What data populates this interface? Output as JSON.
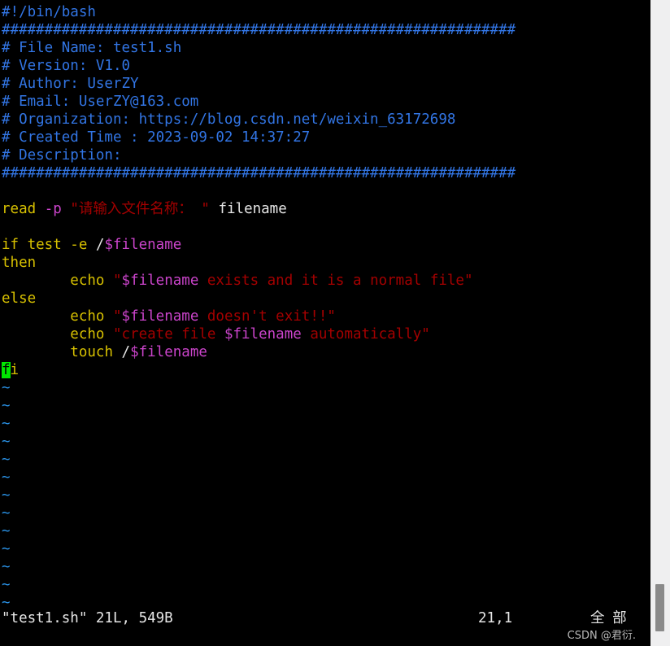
{
  "editor": {
    "name": "vim",
    "filename": "test1.sh"
  },
  "code_lines": [
    {
      "kind": "code",
      "spans": [
        {
          "t": "#!/bin/bash",
          "c": "c-comment"
        }
      ]
    },
    {
      "kind": "code",
      "spans": [
        {
          "t": "############################################################",
          "c": "c-comment"
        }
      ]
    },
    {
      "kind": "code",
      "spans": [
        {
          "t": "# File Name: test1.sh",
          "c": "c-comment"
        }
      ]
    },
    {
      "kind": "code",
      "spans": [
        {
          "t": "# Version: V1.0",
          "c": "c-comment"
        }
      ]
    },
    {
      "kind": "code",
      "spans": [
        {
          "t": "# Author: UserZY",
          "c": "c-comment"
        }
      ]
    },
    {
      "kind": "code",
      "spans": [
        {
          "t": "# Email: UserZY@163.com",
          "c": "c-comment"
        }
      ]
    },
    {
      "kind": "code",
      "spans": [
        {
          "t": "# Organization: https://blog.csdn.net/weixin_63172698",
          "c": "c-comment"
        }
      ]
    },
    {
      "kind": "code",
      "spans": [
        {
          "t": "# Created Time : 2023-09-02 14:37:27",
          "c": "c-comment"
        }
      ]
    },
    {
      "kind": "code",
      "spans": [
        {
          "t": "# Description:",
          "c": "c-comment"
        }
      ]
    },
    {
      "kind": "code",
      "spans": [
        {
          "t": "############################################################",
          "c": "c-comment"
        }
      ]
    },
    {
      "kind": "blank",
      "spans": [
        {
          "t": " ",
          "c": "c-plain"
        }
      ]
    },
    {
      "kind": "code",
      "spans": [
        {
          "t": "read ",
          "c": "c-keyword"
        },
        {
          "t": "-p",
          "c": "c-flag"
        },
        {
          "t": " ",
          "c": "c-plain"
        },
        {
          "t": "\"请输入文件名称： \"",
          "c": "c-string"
        },
        {
          "t": " filename",
          "c": "c-plain"
        }
      ]
    },
    {
      "kind": "blank",
      "spans": [
        {
          "t": " ",
          "c": "c-plain"
        }
      ]
    },
    {
      "kind": "code",
      "spans": [
        {
          "t": "if test -e ",
          "c": "c-keyword"
        },
        {
          "t": "/",
          "c": "c-plain"
        },
        {
          "t": "$filename",
          "c": "c-var"
        }
      ]
    },
    {
      "kind": "code",
      "spans": [
        {
          "t": "then",
          "c": "c-keyword"
        }
      ]
    },
    {
      "kind": "code",
      "spans": [
        {
          "t": "        ",
          "c": "c-plain"
        },
        {
          "t": "echo ",
          "c": "c-keyword"
        },
        {
          "t": "\"",
          "c": "c-string"
        },
        {
          "t": "$filename",
          "c": "c-var"
        },
        {
          "t": " exists and it is a normal file\"",
          "c": "c-string"
        }
      ]
    },
    {
      "kind": "code",
      "spans": [
        {
          "t": "else",
          "c": "c-keyword"
        }
      ]
    },
    {
      "kind": "code",
      "spans": [
        {
          "t": "        ",
          "c": "c-plain"
        },
        {
          "t": "echo ",
          "c": "c-keyword"
        },
        {
          "t": "\"",
          "c": "c-string"
        },
        {
          "t": "$filename",
          "c": "c-var"
        },
        {
          "t": " doesn't exit!!\"",
          "c": "c-string"
        }
      ]
    },
    {
      "kind": "code",
      "spans": [
        {
          "t": "        ",
          "c": "c-plain"
        },
        {
          "t": "echo ",
          "c": "c-keyword"
        },
        {
          "t": "\"create file ",
          "c": "c-string"
        },
        {
          "t": "$filename",
          "c": "c-var"
        },
        {
          "t": " automatically\"",
          "c": "c-string"
        }
      ]
    },
    {
      "kind": "code",
      "spans": [
        {
          "t": "        ",
          "c": "c-plain"
        },
        {
          "t": "touch ",
          "c": "c-keyword"
        },
        {
          "t": "/",
          "c": "c-plain"
        },
        {
          "t": "$filename",
          "c": "c-var"
        }
      ]
    },
    {
      "kind": "code",
      "spans": [
        {
          "t": "f",
          "c": "c-keyword cursor"
        },
        {
          "t": "i",
          "c": "c-keyword"
        }
      ]
    }
  ],
  "tilde_lines": [
    {
      "t": "~"
    },
    {
      "t": "~"
    },
    {
      "t": "~"
    },
    {
      "t": "~"
    },
    {
      "t": "~"
    },
    {
      "t": "~"
    },
    {
      "t": "~"
    },
    {
      "t": "~"
    },
    {
      "t": "~"
    },
    {
      "t": "~"
    },
    {
      "t": "~"
    },
    {
      "t": "~"
    },
    {
      "t": "~"
    }
  ],
  "status": {
    "file_info": "\"test1.sh\" 21L, 549B",
    "position": "21,1",
    "scroll_indicator": "全 部"
  },
  "watermark": {
    "text": "CSDN @君衍."
  },
  "colors": {
    "background": "#000000",
    "comment": "#3275e4",
    "keyword": "#d7c000",
    "string": "#a40000",
    "variable": "#cb44cb",
    "plain": "#e6e6e6",
    "tilde": "#2a93e8",
    "cursor": "#00e800",
    "scrollbar_track": "#efeff0",
    "scrollbar_thumb": "#8a8a8a"
  }
}
